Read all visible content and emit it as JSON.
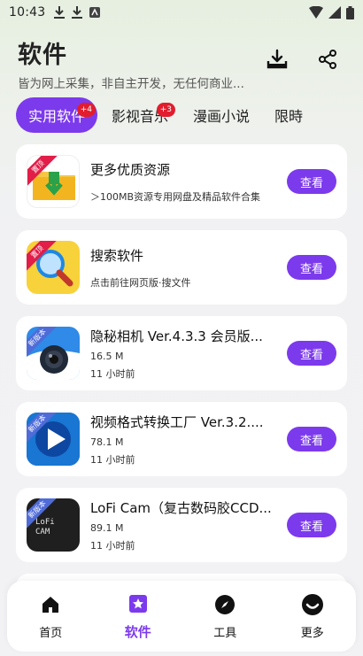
{
  "status_bar": {
    "time": "10:43"
  },
  "header": {
    "title": "软件",
    "subtitle": "皆为网上采集，非自主开发，无任何商业..."
  },
  "tabs": [
    {
      "label": "实用软件",
      "badge": "+4",
      "active": true
    },
    {
      "label": "影视音乐",
      "badge": "+3",
      "active": false
    },
    {
      "label": "漫画小说",
      "badge": "",
      "active": false
    },
    {
      "label": "限時",
      "badge": "",
      "active": false
    }
  ],
  "items": [
    {
      "title": "更多优质资源",
      "desc": "＞100MB资源专用网盘及精品软件合集",
      "ribbon": "置顶",
      "button": "查看",
      "icon": "download-folder-icon"
    },
    {
      "title": "搜索软件",
      "desc": "点击前往网页版·搜文件",
      "ribbon": "置顶",
      "button": "查看",
      "icon": "magnifier-icon"
    },
    {
      "title": "隐秘相机 Ver.4.3.3 会员版...",
      "size": "16.5 M",
      "time": "11 小时前",
      "ribbon": "新版本",
      "button": "查看",
      "icon": "camera-icon"
    },
    {
      "title": "视频格式转换工厂 Ver.3.2....",
      "size": "78.1 M",
      "time": "11 小时前",
      "ribbon": "新版本",
      "button": "查看",
      "icon": "play-icon"
    },
    {
      "title": "LoFi Cam（复古数码胶CCD...",
      "size": "89.1 M",
      "time": "11 小时前",
      "ribbon": "新版本",
      "button": "查看",
      "icon": "lofi-cam-icon",
      "thumb_text": "LoFi CAM"
    }
  ],
  "bottom_nav": [
    {
      "label": "首页",
      "icon": "home-icon",
      "active": false
    },
    {
      "label": "软件",
      "icon": "star-box-icon",
      "active": true
    },
    {
      "label": "工具",
      "icon": "compass-icon",
      "active": false
    },
    {
      "label": "更多",
      "icon": "smile-icon",
      "active": false
    }
  ],
  "colors": {
    "accent": "#7c3aed",
    "badge": "#e11d2e"
  }
}
